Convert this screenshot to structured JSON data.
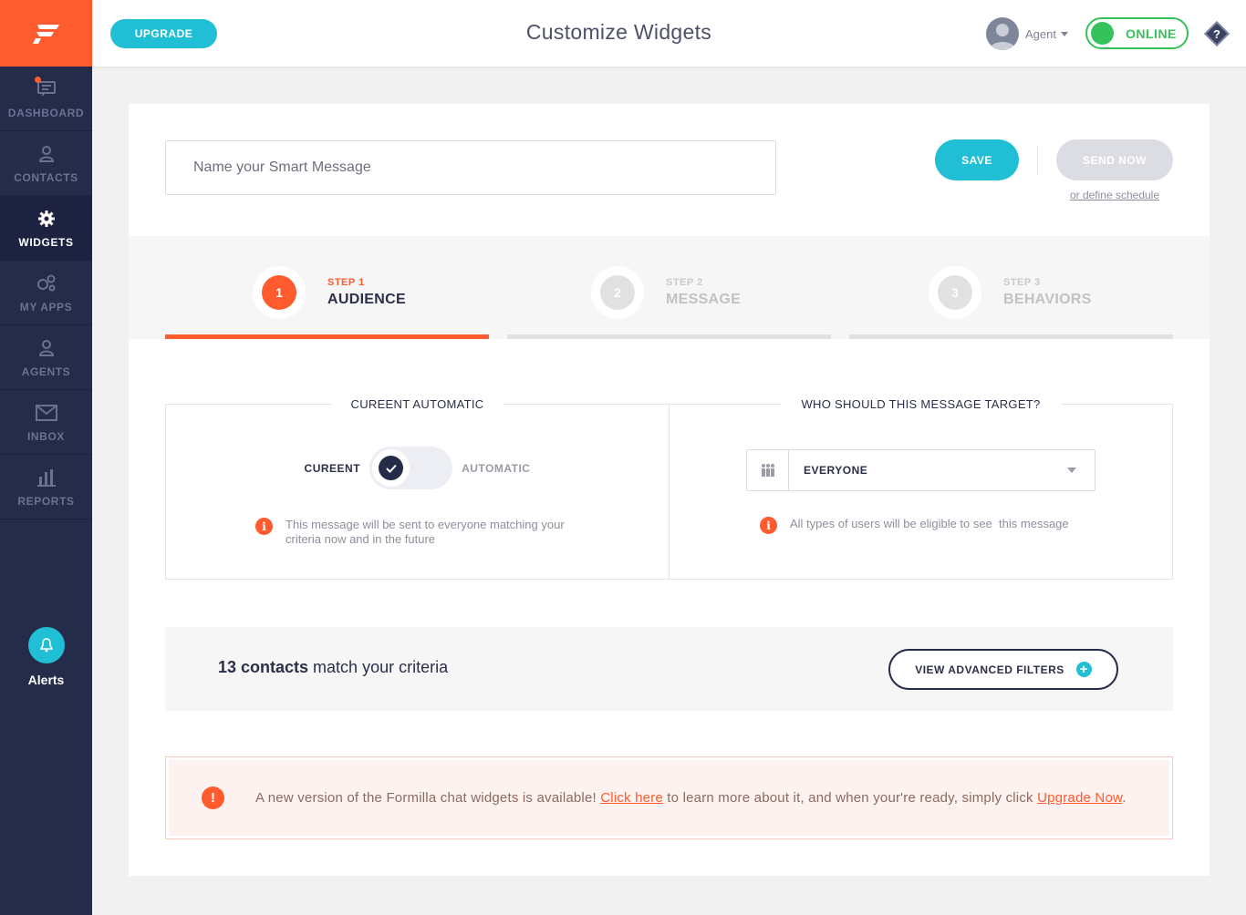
{
  "colors": {
    "accent_orange": "#ff5b2e",
    "accent_cyan": "#21bfd6",
    "sidebar_bg": "#252c4a",
    "online_green": "#36c25a"
  },
  "sidebar": {
    "logo_icon": "formilla-logo-icon",
    "items": [
      {
        "label": "DASHBOARD",
        "icon": "chat-icon",
        "active": false
      },
      {
        "label": "CONTACTS",
        "icon": "contacts-icon",
        "active": false
      },
      {
        "label": "WIDGETS",
        "icon": "gear-icon",
        "active": true
      },
      {
        "label": "MY APPS",
        "icon": "apps-icon",
        "active": false
      },
      {
        "label": "AGENTS",
        "icon": "agents-icon",
        "active": false
      },
      {
        "label": "INBOX",
        "icon": "envelope-icon",
        "active": false
      },
      {
        "label": "REPORTS",
        "icon": "bar-chart-icon",
        "active": false
      }
    ],
    "alerts_label": "Alerts"
  },
  "header": {
    "upgrade_label": "UPGRADE",
    "title": "Customize Widgets",
    "agent_label": "Agent",
    "status_label": "ONLINE",
    "help_label": "?"
  },
  "form": {
    "name_placeholder": "Name your Smart Message",
    "name_value": "",
    "save_label": "SAVE",
    "send_label": "SEND NOW",
    "schedule_link": "or define schedule"
  },
  "steps": [
    {
      "number": "1",
      "small": "STEP 1",
      "title": "AUDIENCE",
      "active": true
    },
    {
      "number": "2",
      "small": "STEP 2",
      "title": "MESSAGE",
      "active": false
    },
    {
      "number": "3",
      "small": "STEP 3",
      "title": "BEHAVIORS",
      "active": false
    }
  ],
  "automatic_box": {
    "title": "CUREENT AUTOMATIC",
    "left_label": "CUREENT",
    "right_label": "AUTOMATIC",
    "info_icon": "i",
    "info_line1": "This message will be sent to everyone matching your",
    "info_line2": "criteria now and in the future"
  },
  "target_box": {
    "title": "WHO SHOULD THIS MESSAGE TARGET?",
    "selected": "EVERYONE",
    "info_icon": "i",
    "info": "All types of users will be eligible to see  this message"
  },
  "match": {
    "count_text": "13 contacts",
    "rest_text": " match your criteria",
    "filters_label": "VIEW ADVANCED FILTERS",
    "plus": "+"
  },
  "notice": {
    "icon": "!",
    "part1": "A new version of the Formilla chat widgets is available! ",
    "link1": "Click here",
    "part2": " to learn more about it, and when your're ready, simply click ",
    "link2": "Upgrade Now",
    "part3": "."
  }
}
